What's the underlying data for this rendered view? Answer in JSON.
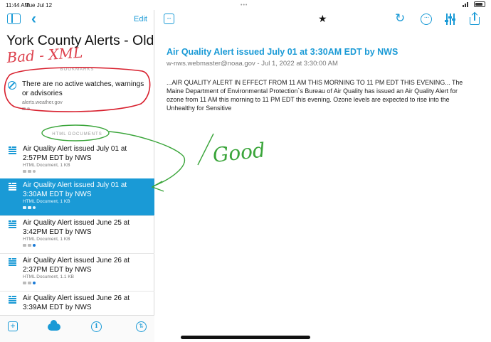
{
  "status_bar": {
    "time": "11:44 AM",
    "date": "Tue Jul 12",
    "dots": "•••"
  },
  "sidebar": {
    "edit_label": "Edit",
    "title": "York County Alerts - Old",
    "bookmarks_header": "BOOKMARKS",
    "bookmark": {
      "text": "There are no active watches, warnings or advisories",
      "url": "alerts.weather.gov"
    },
    "html_header": "HTML DOCUMENTS",
    "documents": [
      {
        "title": "Air Quality Alert issued July 01 at 2:57PM EDT by NWS",
        "meta": "HTML Document, 1 KB",
        "selected": false,
        "dot": "gray"
      },
      {
        "title": "Air Quality Alert issued July 01 at 3:30AM EDT by NWS",
        "meta": "HTML Document, 1 KB",
        "selected": true,
        "dot": "white"
      },
      {
        "title": "Air Quality Alert issued June 25 at 3:42PM EDT by NWS",
        "meta": "HTML Document, 1 KB",
        "selected": false,
        "dot": "blue"
      },
      {
        "title": "Air Quality Alert issued June 26 at 2:37PM EDT by NWS",
        "meta": "HTML Document, 1.1 KB",
        "selected": false,
        "dot": "blue"
      },
      {
        "title": "Air Quality Alert issued June 26 at 3:39AM EDT by NWS",
        "meta": "",
        "selected": false,
        "dot": ""
      }
    ],
    "bottom_bar": {
      "info_glyph": "i",
      "sort_glyph": "⇅",
      "add_glyph": "+"
    }
  },
  "main": {
    "star_glyph": "★",
    "article": {
      "title": "Air Quality Alert issued July 01 at 3:30AM EDT by NWS",
      "meta": "w-nws.webmaster@noaa.gov - Jul 1, 2022 at 3:30:00 AM",
      "body": "...AIR QUALITY ALERT IN EFFECT FROM 11 AM THIS MORNING TO 11 PM EDT THIS EVENING... The Maine Department of Environmental Protection`s Bureau of Air Quality has issued an Air Quality Alert for ozone from 11 AM this morning to 11 PM EDT this evening. Ozone levels are expected to rise into the Unhealthy for Sensitive"
    }
  },
  "annotations": {
    "bad_label": "Bad - XML",
    "good_label": "Good"
  },
  "colors": {
    "accent": "#1a9ad6",
    "ink_red": "#d8202e",
    "ink_green": "#3aa53a"
  }
}
